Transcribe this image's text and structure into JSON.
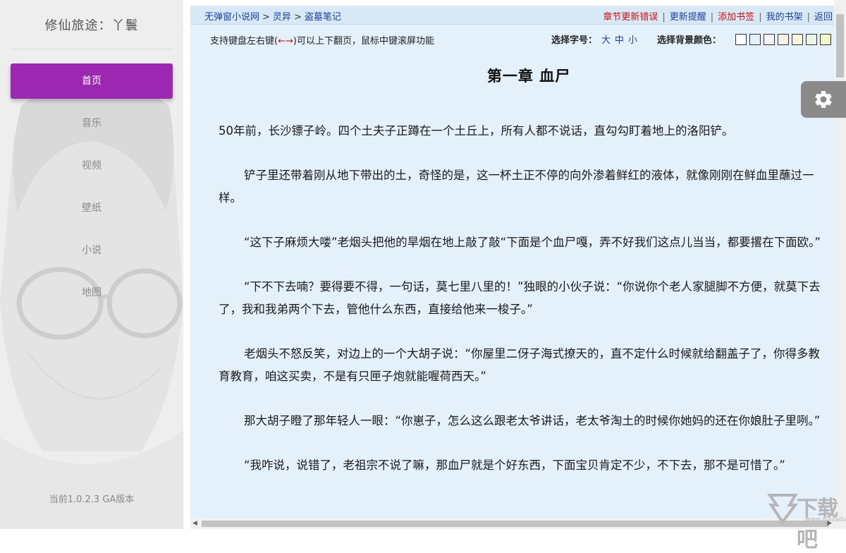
{
  "app": {
    "title": "修仙旅途：丫鬟",
    "version": "当前1.0.2.3 GA版本"
  },
  "sidebar": {
    "items": [
      {
        "label": "首页",
        "active": true
      },
      {
        "label": "音乐",
        "active": false
      },
      {
        "label": "视频",
        "active": false
      },
      {
        "label": "壁纸",
        "active": false
      },
      {
        "label": "小说",
        "active": false
      },
      {
        "label": "地图",
        "active": false
      }
    ]
  },
  "reader": {
    "breadcrumb": [
      "无弹窗小说网",
      "灵异",
      "盗墓笔记"
    ],
    "breadcrumb_sep": ">",
    "top_links": [
      {
        "label": "章节更新错误",
        "color": "#d01010"
      },
      {
        "label": "更新提醒",
        "color": "#1a3fb0"
      },
      {
        "label": "添加书签",
        "color": "#d01010"
      },
      {
        "label": "我的书架",
        "color": "#1a3fb0"
      },
      {
        "label": "返回",
        "color": "#1a3fb0"
      }
    ],
    "link_sep": "|",
    "hint_prefix": "支持键盘左右键(",
    "hint_arrows": "←→",
    "hint_suffix": ")可以上下翻页，鼠标中键滚屏功能",
    "font_size_label": "选择字号：",
    "font_sizes": [
      "大",
      "中",
      "小"
    ],
    "bg_color_label": "选择背景颜色：",
    "bg_colors": [
      "#ffffff",
      "#e4f0fa",
      "#f3f3f3",
      "#f7f2e8",
      "#fbf3df",
      "#eaf5e4",
      "#f4f9c8",
      "#dff3cf"
    ],
    "chapter_title": "第一章  血尸",
    "paragraphs": [
      "50年前，长沙镖子岭。四个土夫子正蹲在一个土丘上，所有人都不说话，直勾勾盯着地上的洛阳铲。",
      "铲子里还带着刚从地下带出的土，奇怪的是，这一杯土正不停的向外渗着鲜红的液体，就像刚刚在鲜血里蘸过一样。",
      "“这下子麻烦大喽”老烟头把他的旱烟在地上敲了敲“下面是个血尸嘎，弄不好我们这点儿当当，都要撂在下面欧。”",
      "“下不下去喃？要得要不得，一句话，莫七里八里的！”独眼的小伙子说：“你说你个老人家腿脚不方便，就莫下去了，我和我弟两个下去，管他什么东西，直接给他来一梭子。”",
      "老烟头不怒反笑，对边上的一个大胡子说：“你屋里二伢子海式撩天的，直不定什么时候就给翻盖子了，你得多教育教育，咱这买卖，不是有只匣子炮就能喔荷西天。”",
      "那大胡子瞪了那年轻人一眼：“你崽子，怎么这么跟老太爷讲话，老太爷淘土的时候你她妈的还在你娘肚子里咧。”",
      "“我咋说，说错了，老祖宗不说了嘛，那血尸就是个好东西，下面宝贝肯定不少，不下去，那不是可惜了。”"
    ]
  },
  "watermark": {
    "text": "下载吧",
    "sub": "www.xiazaiba.com"
  }
}
